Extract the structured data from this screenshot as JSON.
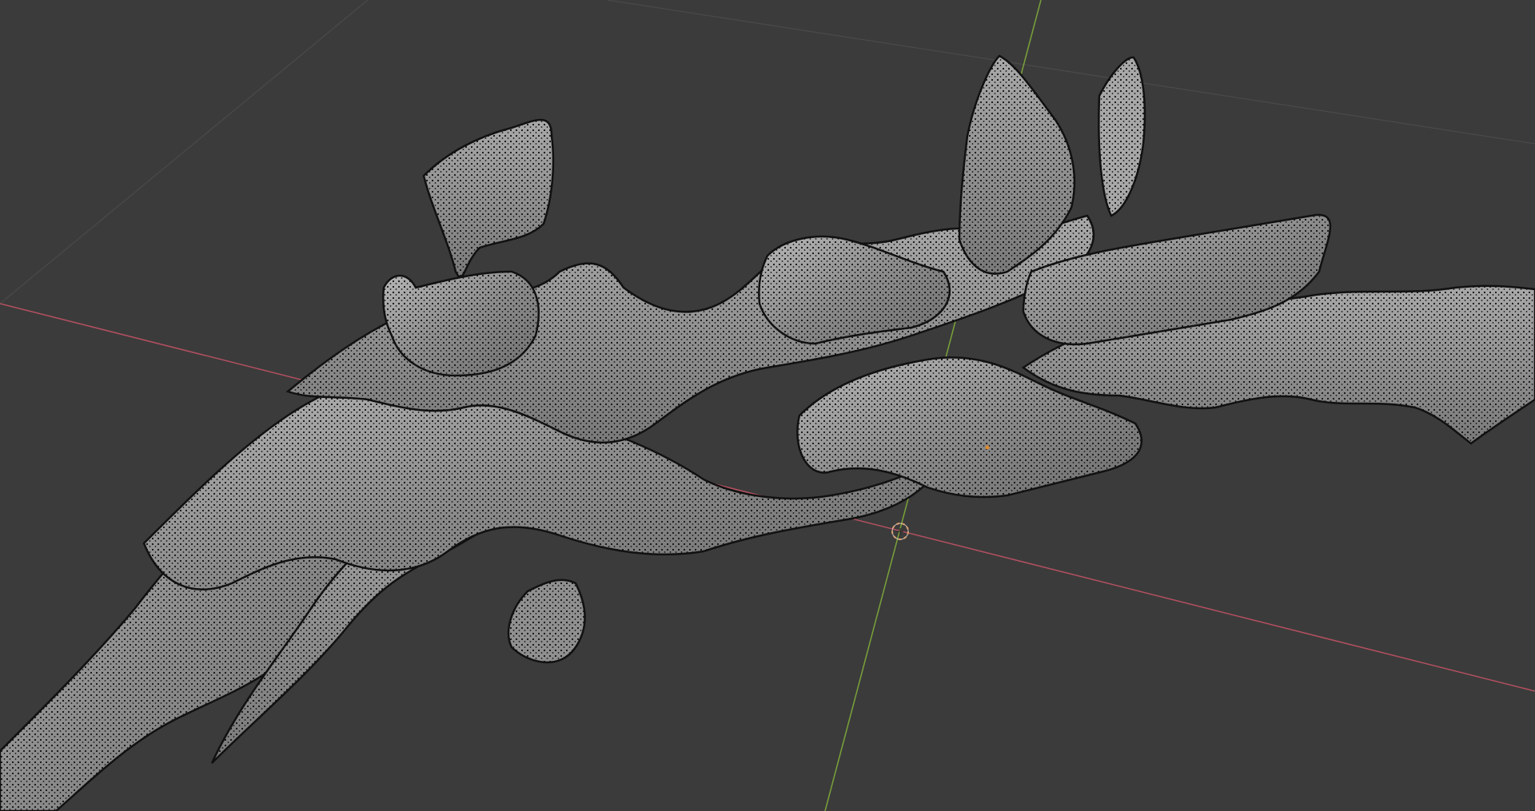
{
  "app": "3D viewport",
  "colors": {
    "background": "#3b3b3b",
    "grid_line": "#4a4a4a",
    "axis_x": "#b35060",
    "axis_y": "#7aa23a",
    "mesh_fill": "#8e8e8e",
    "mesh_fill_light": "#b5b5b5",
    "mesh_wire": "#1a1a1a",
    "mesh_vertex": "#0d0d0d",
    "cursor_ring": "#d9a070",
    "origin_point": "#e08a30"
  },
  "icons": {
    "cursor": "3d-cursor-icon",
    "origin": "object-origin-icon"
  },
  "viewport": {
    "mode": "edit-mesh",
    "show_wireframe": true,
    "show_vertices": true,
    "show_floor_grid": true
  }
}
